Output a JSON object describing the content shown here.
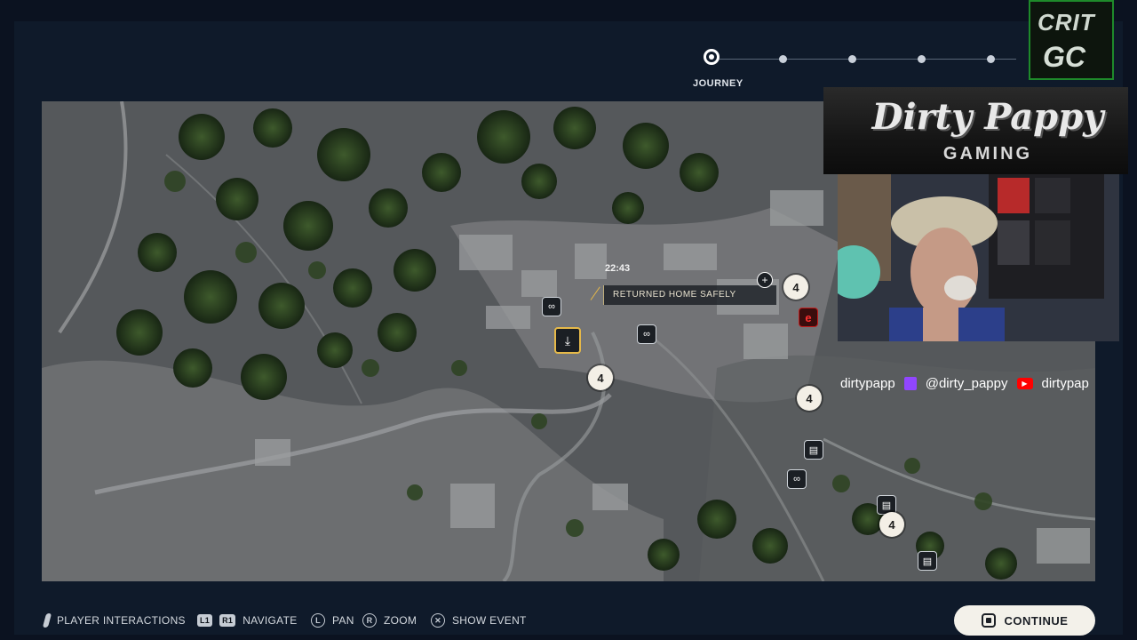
{
  "timeline": {
    "current_label": "JOURNEY"
  },
  "map": {
    "tooltip": {
      "time": "22:43",
      "event": "RETURNED HOME SAFELY"
    },
    "pins": [
      {
        "value": "4"
      },
      {
        "value": "4"
      },
      {
        "value": "4"
      },
      {
        "value": "4"
      }
    ]
  },
  "overlay": {
    "crit_logo_line1": "CRIT",
    "crit_logo_line2": "GC",
    "banner_title": "Dirty Pappy",
    "banner_subtitle": "GAMING",
    "social": {
      "handle1": "dirtypapp",
      "twitch_handle": "@dirty_pappy",
      "youtube_handle": "dirtypap"
    }
  },
  "controls": {
    "player_interactions": "PLAYER INTERACTIONS",
    "l1": "L1",
    "r1": "R1",
    "navigate": "NAVIGATE",
    "l_stick": "L",
    "pan": "PAN",
    "r_stick": "R",
    "zoom": "ZOOM",
    "cross": "✕",
    "show_event": "SHOW EVENT",
    "continue": "CONTINUE"
  },
  "colors": {
    "accent_selected": "#e6b949",
    "danger_icon": "#c21b1b",
    "twitch": "#9146ff",
    "youtube": "#ff0000"
  }
}
